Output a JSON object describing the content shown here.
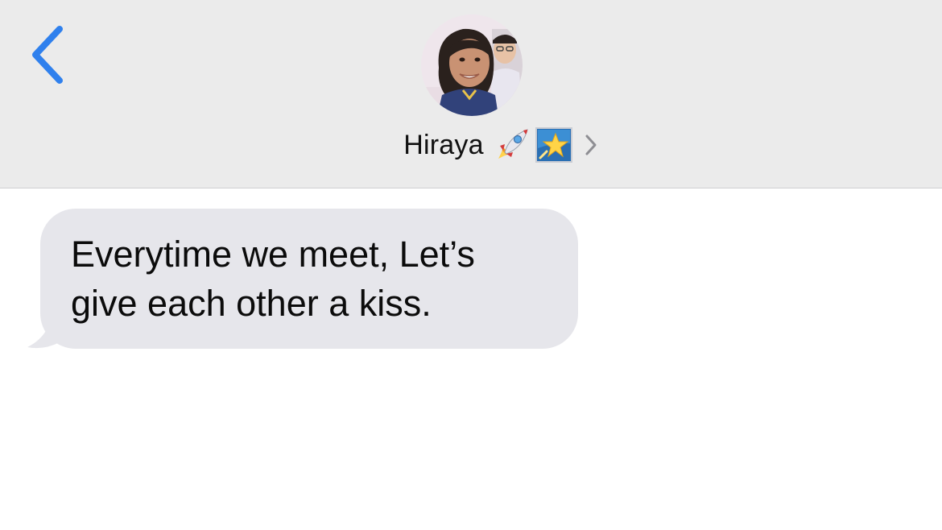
{
  "header": {
    "back_icon": "chevron-left-icon",
    "contact": {
      "name": "Hiraya",
      "avatar": "contact-photo",
      "emoji": [
        "rocket-icon",
        "star-icon"
      ],
      "details_icon": "chevron-right-icon"
    }
  },
  "messages": [
    {
      "direction": "received",
      "text": "Everytime we meet, Let’s\ngive each other a kiss."
    }
  ],
  "colors": {
    "header_bg": "#ebebeb",
    "accent_blue": "#2f80ed",
    "received_bubble": "#e6e6eb",
    "text": "#0b0b0b"
  }
}
